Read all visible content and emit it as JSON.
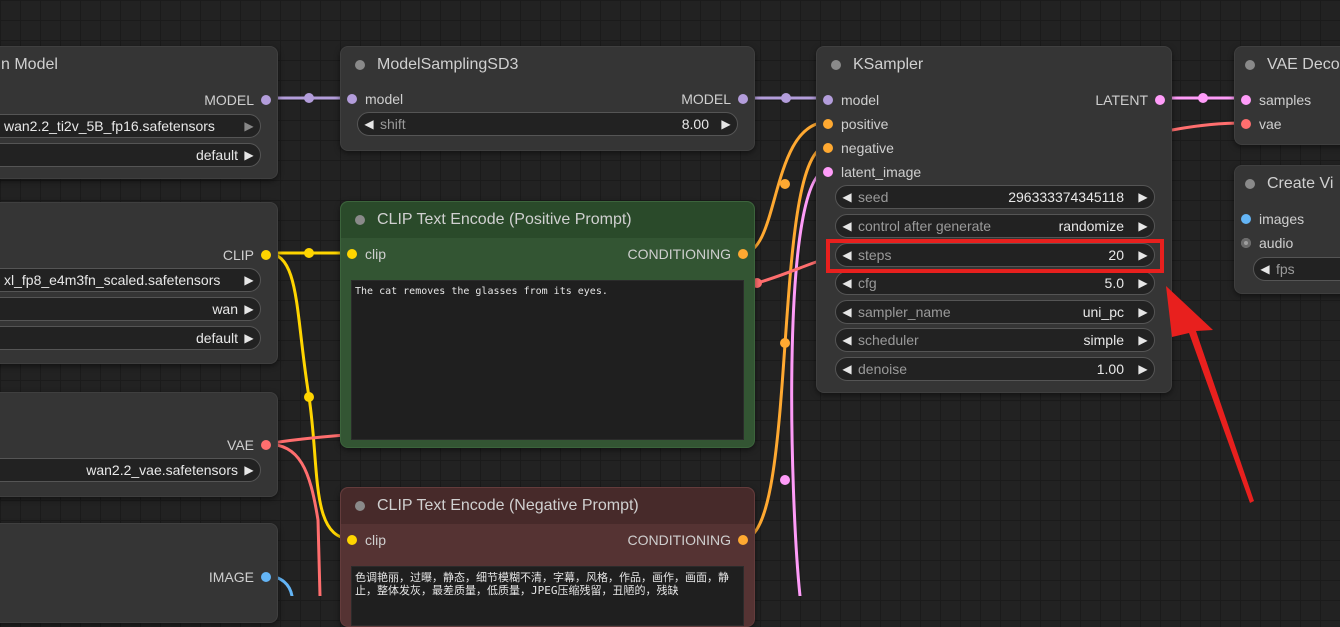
{
  "nodes": {
    "load_model": {
      "title": "n Model",
      "output": "MODEL",
      "widgets": [
        {
          "value": "wan2.2_ti2v_5B_fp16.safetensors"
        },
        {
          "value": "default"
        }
      ]
    },
    "load_clip": {
      "output": "CLIP",
      "widgets": [
        {
          "value": "xl_fp8_e4m3fn_scaled.safetensors"
        },
        {
          "value": "wan"
        },
        {
          "value": "default"
        }
      ]
    },
    "load_vae": {
      "output": "VAE",
      "widgets": [
        {
          "value": "wan2.2_vae.safetensors"
        }
      ]
    },
    "load_image": {
      "output": "IMAGE"
    },
    "model_sampling": {
      "title": "ModelSamplingSD3",
      "input": "model",
      "output": "MODEL",
      "widget": {
        "label": "shift",
        "value": "8.00"
      }
    },
    "clip_positive": {
      "title": "CLIP Text Encode (Positive Prompt)",
      "input": "clip",
      "output": "CONDITIONING",
      "text": "The cat removes the glasses from its eyes."
    },
    "clip_negative": {
      "title": "CLIP Text Encode (Negative Prompt)",
      "input": "clip",
      "output": "CONDITIONING",
      "text": "色调艳丽，过曝，静态，细节模糊不清，字幕，风格，作品，画作，画面，静止，整体发灰，最差质量，低质量，JPEG压缩残留，丑陋的，残缺"
    },
    "ksampler": {
      "title": "KSampler",
      "inputs": [
        "model",
        "positive",
        "negative",
        "latent_image"
      ],
      "output": "LATENT",
      "widgets": [
        {
          "label": "seed",
          "value": "296333374345118"
        },
        {
          "label": "control after generate",
          "value": "randomize"
        },
        {
          "label": "steps",
          "value": "20"
        },
        {
          "label": "cfg",
          "value": "5.0"
        },
        {
          "label": "sampler_name",
          "value": "uni_pc"
        },
        {
          "label": "scheduler",
          "value": "simple"
        },
        {
          "label": "denoise",
          "value": "1.00"
        }
      ]
    },
    "vae_decode": {
      "title": "VAE Deco",
      "inputs": [
        "samples",
        "vae"
      ]
    },
    "create_video": {
      "title": "Create Vi",
      "inputs": [
        "images",
        "audio"
      ],
      "widget": {
        "label": "fps"
      }
    }
  },
  "colors": {
    "model": "#b39ddb",
    "conditioning": "#ffa931",
    "latent": "#ff9cf9",
    "clip": "#ffd500",
    "vae": "#ff6e6e",
    "image": "#64b5f6",
    "annotation": "#e8201e"
  }
}
